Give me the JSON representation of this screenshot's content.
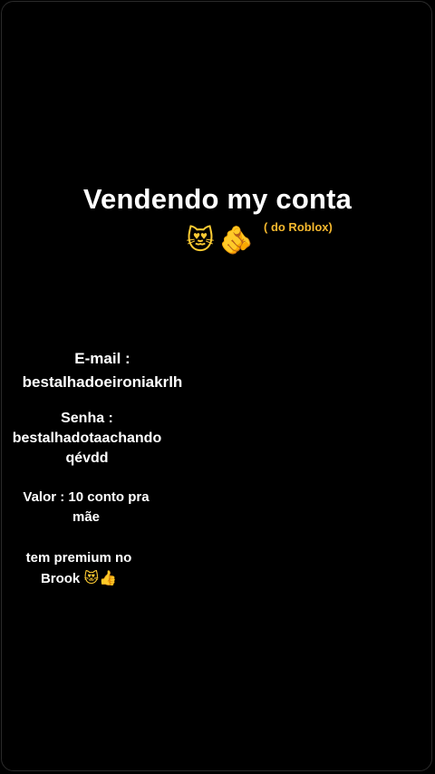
{
  "story": {
    "title": "Vendendo my conta",
    "subtitle": "( do Roblox)",
    "title_emojis": [
      "😻",
      "🫵"
    ],
    "email_label": "E-mail :",
    "email_value": "bestalhadoeironiakrlh",
    "senha_label": "Senha :",
    "senha_value_line1": "bestalhadotaachando",
    "senha_value_line2": "qévdd",
    "valor_line1": "Valor : 10 conto pra",
    "valor_line2": "mãe",
    "premium_line1": "tem premium no",
    "premium_line2": "Brook",
    "premium_emojis": [
      "😻",
      "👍"
    ]
  },
  "colors": {
    "background": "#000000",
    "text": "#ffffff",
    "accent": "#f5b82e"
  }
}
